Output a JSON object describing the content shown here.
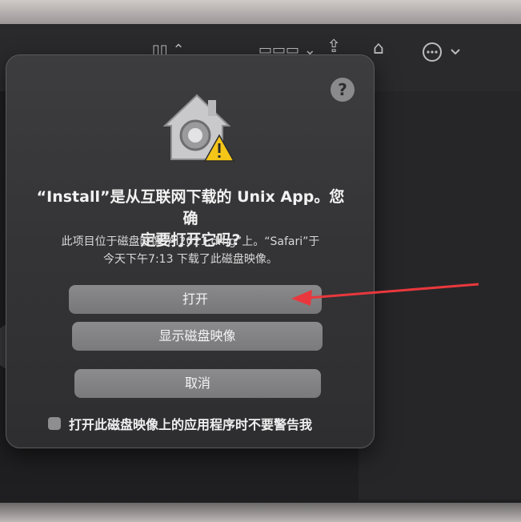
{
  "toolbar": {
    "icons": [
      "sidebar-toggle-icon",
      "grid-view-icon",
      "share-icon",
      "tag-icon",
      "more-actions-icon"
    ]
  },
  "dialog": {
    "title_line1": "“Install”是从互联网下载的 Unix App。您确",
    "title_line2": "定要打开它吗?",
    "message_line1": "此项目位于磁盘映像“AI2021.dmg”上。“Safari”于",
    "message_line2": "今天下午7:13 下载了此磁盘映像。",
    "help_label": "?",
    "open_label": "打开",
    "show_disk_image_label": "显示磁盘映像",
    "cancel_label": "取消",
    "checkbox_label": "打开此磁盘映像上的应用程序时不要警告我",
    "checkbox_checked": false
  },
  "colors": {
    "annotation_arrow": "#e8383d",
    "warning_triangle": "#f5c518"
  }
}
